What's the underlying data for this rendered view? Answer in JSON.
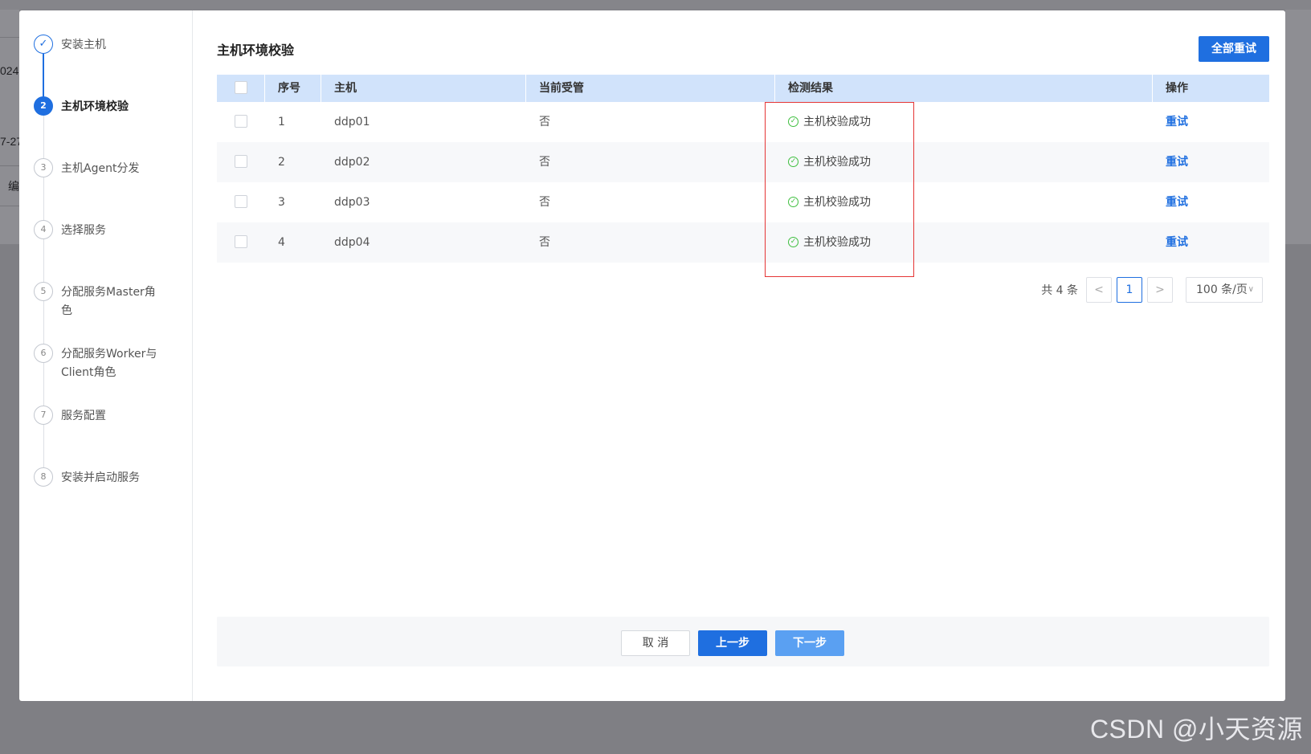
{
  "background": {
    "fragments": [
      "024(",
      "7-27",
      "编"
    ]
  },
  "steps": [
    {
      "num": "✓",
      "label": "安装主机",
      "state": "done"
    },
    {
      "num": "2",
      "label": "主机环境校验",
      "state": "active"
    },
    {
      "num": "3",
      "label": "主机Agent分发",
      "state": "pending"
    },
    {
      "num": "4",
      "label": "选择服务",
      "state": "pending"
    },
    {
      "num": "5",
      "label": "分配服务Master角色",
      "state": "pending"
    },
    {
      "num": "6",
      "label": "分配服务Worker与Client角色",
      "state": "pending"
    },
    {
      "num": "7",
      "label": "服务配置",
      "state": "pending"
    },
    {
      "num": "8",
      "label": "安装并启动服务",
      "state": "pending"
    }
  ],
  "main": {
    "title": "主机环境校验",
    "retry_all_label": "全部重试"
  },
  "table": {
    "headers": {
      "index": "序号",
      "host": "主机",
      "managed": "当前受管",
      "result": "检测结果",
      "op": "操作"
    },
    "rows": [
      {
        "index": "1",
        "host": "ddp01",
        "managed": "否",
        "result": "主机校验成功",
        "op": "重试"
      },
      {
        "index": "2",
        "host": "ddp02",
        "managed": "否",
        "result": "主机校验成功",
        "op": "重试"
      },
      {
        "index": "3",
        "host": "ddp03",
        "managed": "否",
        "result": "主机校验成功",
        "op": "重试"
      },
      {
        "index": "4",
        "host": "ddp04",
        "managed": "否",
        "result": "主机校验成功",
        "op": "重试"
      }
    ]
  },
  "pagination": {
    "total_text": "共 4 条",
    "prev": "<",
    "current_page": "1",
    "next": ">",
    "page_size": "100 条/页"
  },
  "footer": {
    "cancel_label": "取 消",
    "prev_label": "上一步",
    "next_label": "下一步"
  },
  "watermark": "CSDN @小天资源",
  "colors": {
    "primary": "#1f6fe0",
    "header_bg": "#d1e3fb",
    "success": "#3fbf3f",
    "highlight": "#e53535"
  }
}
